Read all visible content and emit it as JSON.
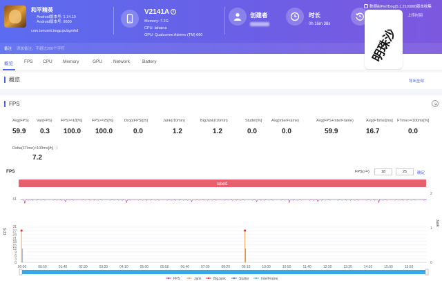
{
  "header": {
    "app": {
      "name": "和平精英",
      "android_version": "Android版本号: 1.14.10",
      "android_code": "Android版本号: 9600",
      "package": "com.tencent.tmgp.pubgmhd"
    },
    "device": {
      "name": "V2141A",
      "memory": "Memory: 7.2G",
      "cpu": "CPU: lahaina",
      "gpu": "GPU: Qualcomm Adreno (TM) 660"
    },
    "creator_label": "创建者",
    "duration_label": "时长",
    "duration": "0h 16m 38s",
    "sync_text": "数据由PerfDog(5.1.210300)版本收集",
    "upload_text": "上传时间",
    "note_label": "备注",
    "note_placeholder": "添加备注，不超过200个字符",
    "watermark": "明珠沙"
  },
  "tabs": [
    "概览",
    "FPS",
    "CPU",
    "Memory",
    "GPU",
    "Network",
    "Battery"
  ],
  "overview": {
    "title": "概览",
    "export": "导出全部"
  },
  "fps_section": {
    "title": "FPS",
    "metrics": [
      {
        "label": "Avg(FPS)",
        "value": "59.9"
      },
      {
        "label": "Var(FPS)",
        "value": "0.3"
      },
      {
        "label": "FPS>=18[%]",
        "value": "100.0"
      },
      {
        "label": "FPS>=25[%]",
        "value": "100.0"
      },
      {
        "label": "Drop(FPS)[/h]",
        "value": "0.0"
      },
      {
        "label": "Jank(/10min)",
        "value": "1.2"
      },
      {
        "label": "BigJank(/10min)",
        "value": "1.2"
      },
      {
        "label": "Stutter[%]",
        "value": "0.0"
      },
      {
        "label": "Avg(InterFrame)",
        "value": "0.0"
      },
      {
        "label": "Avg(FPS+InterFrame)",
        "value": "59.9"
      },
      {
        "label": "Avg(FTime)[ms]",
        "value": "16.7"
      },
      {
        "label": "FTime>=100ms[%]",
        "value": "0.0"
      },
      {
        "label": "Delta(FTime)>100ms[/h]",
        "value": "7.2"
      }
    ]
  },
  "chart_controls": {
    "title": "FPS",
    "fps_filter_label": "FPS(>=)",
    "fps_low": "18",
    "fps_high": "25",
    "apply": "确定"
  },
  "colors": {
    "header_start": "#5b6cf0",
    "header_end": "#7d58df",
    "accent": "#4d64e8",
    "fps": "#c040c0",
    "jank": "#f5a35b",
    "bigjank": "#e03030",
    "stutter": "#5470c6",
    "interframe": "#5ab0e8",
    "label_band": "#e8606e",
    "slider": "#38a8e8"
  },
  "chart_data": {
    "type": "line",
    "title": "FPS",
    "label_band": "label1",
    "ylabel_left": "FPS",
    "ylabel_right": "Jank",
    "y_left_ticks": [
      0,
      3,
      6,
      9,
      12,
      15,
      18,
      21,
      24,
      27,
      31,
      61
    ],
    "y_right_ticks": [
      0,
      1,
      2
    ],
    "x_ticks": [
      "00:00",
      "00:50",
      "01:40",
      "02:30",
      "03:20",
      "04:10",
      "05:00",
      "05:50",
      "06:40",
      "07:30",
      "08:20",
      "09:10",
      "10:00",
      "10:50",
      "11:40",
      "12:30",
      "13:20",
      "14:10",
      "15:00",
      "15:50"
    ],
    "x_range_seconds": [
      0,
      998
    ],
    "series": [
      {
        "name": "FPS",
        "baseline": 60,
        "min_dips": [
          [
            10,
            56
          ],
          [
            75,
            57
          ],
          [
            110,
            58
          ],
          [
            185,
            58
          ],
          [
            260,
            57
          ],
          [
            335,
            58
          ],
          [
            420,
            58
          ],
          [
            505,
            57
          ],
          [
            580,
            58
          ],
          [
            660,
            57
          ],
          [
            730,
            58
          ],
          [
            805,
            58
          ],
          [
            880,
            57
          ],
          [
            955,
            58
          ]
        ]
      },
      {
        "name": "Jank",
        "spikes_at_seconds": [
          2,
          551
        ]
      },
      {
        "name": "BigJank",
        "spikes_at_seconds": [
          2,
          551
        ]
      },
      {
        "name": "Stutter"
      },
      {
        "name": "InterFrame"
      }
    ],
    "grid": true,
    "legend": "bottom"
  }
}
